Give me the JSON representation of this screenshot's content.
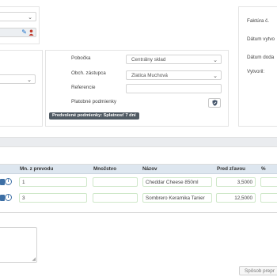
{
  "header_right": {
    "invoice_label": "Faktúra č.",
    "created_date_label": "Dátum vytvo",
    "delivery_date_label": "Dátum doda",
    "created_by_label": "Vytvoril:"
  },
  "details": {
    "branch_label": "Pobočka",
    "branch_value": "Centrálny sklad",
    "rep_label": "Obch. zástupca",
    "rep_value": "Zlatica Muchová",
    "reference_label": "Referencie",
    "reference_value": "",
    "payment_terms_label": "Platobné podmienky",
    "default_terms_badge": "Predvolené podmienky: Splatnosť 7 dní"
  },
  "table": {
    "headers": {
      "qty_transfer": "Mn. z prevodu",
      "qty": "Množstvo",
      "name": "Názov",
      "price": "Pred zľavou",
      "percent": "%"
    },
    "rows": [
      {
        "qty_transfer": "1",
        "qty": "",
        "name": "Cheddar Cheese 850ml",
        "price": "3,5000"
      },
      {
        "qty_transfer": "3",
        "qty": "",
        "name": "Sombrero Keramika Tanier",
        "price": "12,5000"
      }
    ]
  },
  "footer": {
    "payment_method_button": "Spôsob prepr"
  },
  "icons": {
    "edit": "pencil-icon",
    "user": "user-icon",
    "shield": "shield-icon",
    "info": "info-icon",
    "calendar": "calendar-icon"
  },
  "colors": {
    "badge_bg": "#505a63",
    "table_header_bg": "#dde6ef",
    "row_input_border": "#cfe8c9",
    "edit_icon": "#1a6fc9"
  }
}
